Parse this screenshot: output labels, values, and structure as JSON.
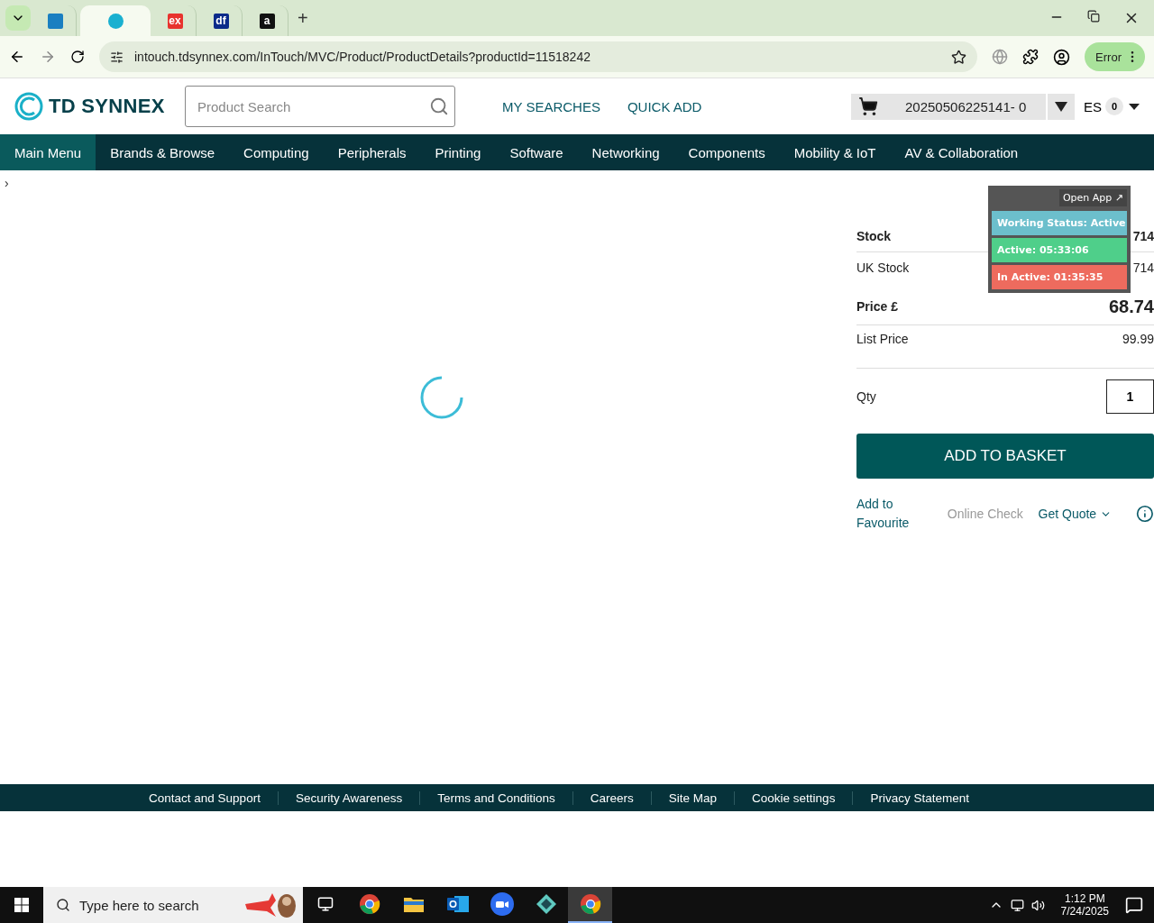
{
  "browser": {
    "tabs": [
      {
        "color": "#1a7fc1",
        "selected": false
      },
      {
        "color": "#1ab0d0",
        "selected": true
      },
      {
        "label": "ex",
        "color": "#e8322d",
        "selected": false
      },
      {
        "label": "df",
        "color": "#0b2a8a",
        "selected": false
      },
      {
        "label": "a",
        "color": "#111111",
        "selected": false
      }
    ],
    "new_tab": "+",
    "url": "intouch.tdsynnex.com/InTouch/MVC/Product/ProductDetails?productId=11518242",
    "profile_status": "Error"
  },
  "header": {
    "logo": "TD SYNNEX",
    "search": {
      "placeholder": "Product Search"
    },
    "links": [
      "MY SEARCHES",
      "QUICK ADD"
    ],
    "basket": "20250506225141- 0",
    "language": "ES",
    "badge": "0"
  },
  "nav": [
    {
      "label": "Main Menu",
      "selected": true
    },
    {
      "label": "Brands & Browse",
      "selected": false
    },
    {
      "label": "Computing",
      "selected": false
    },
    {
      "label": "Peripherals",
      "selected": false
    },
    {
      "label": "Printing",
      "selected": false
    },
    {
      "label": "Software",
      "selected": false
    },
    {
      "label": "Networking",
      "selected": false
    },
    {
      "label": "Components",
      "selected": false
    },
    {
      "label": "Mobility & IoT",
      "selected": false
    },
    {
      "label": "AV & Collaboration",
      "selected": false
    }
  ],
  "breadcrumb": "›",
  "product": {
    "stock": [
      {
        "label": "Stock",
        "value": "714",
        "bold": true
      },
      {
        "label": "UK Stock",
        "value": "714",
        "bold": false
      }
    ],
    "price": {
      "label": "Price £",
      "value": "68.74"
    },
    "list_price": {
      "label": "List Price",
      "value": "99.99"
    },
    "qty": {
      "label": "Qty",
      "value": "1"
    },
    "add_button": "ADD TO BASKET",
    "actions": [
      {
        "label": "Add to Favourite",
        "disabled": false
      },
      {
        "label": "Online Check",
        "disabled": true
      }
    ],
    "quote": "Get Quote"
  },
  "tracker": {
    "open_app": "Open App ↗",
    "rows": [
      {
        "text": "Working Status: Active",
        "color": "#6cbfcc"
      },
      {
        "text": "Active: 05:33:06",
        "color": "#4fcf8a"
      },
      {
        "text": "In Active: 01:35:35",
        "color": "#ee6b5e"
      }
    ]
  },
  "footer": [
    "Contact and Support",
    "Security Awareness",
    "Terms and Conditions",
    "Careers",
    "Site Map",
    "Cookie settings",
    "Privacy Statement"
  ],
  "taskbar": {
    "search_placeholder": "Type here to search",
    "apps": [
      {
        "kind": "taskview",
        "selected": false
      },
      {
        "kind": "chrome",
        "selected": false
      },
      {
        "kind": "folder",
        "selected": false
      },
      {
        "kind": "outlook",
        "selected": false
      },
      {
        "kind": "zoom",
        "selected": false
      },
      {
        "kind": "diamond",
        "selected": false
      },
      {
        "kind": "chrome",
        "selected": true
      }
    ],
    "time": "1:12 PM",
    "date": "7/24/2025"
  }
}
